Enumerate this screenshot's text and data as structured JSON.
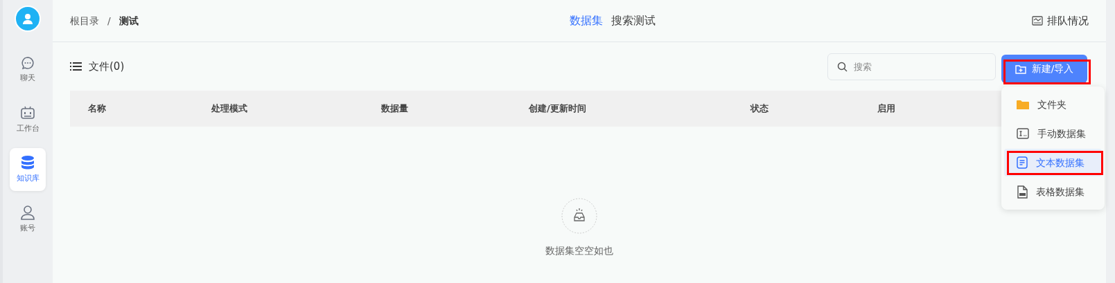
{
  "sidebar": {
    "items": [
      {
        "label": "聊天",
        "kind": "chat",
        "selected": false
      },
      {
        "label": "工作台",
        "kind": "robot",
        "selected": false
      },
      {
        "label": "知识库",
        "kind": "database",
        "selected": true
      },
      {
        "label": "账号",
        "kind": "user",
        "selected": false
      }
    ]
  },
  "breadcrumb": [
    {
      "label": "根目录",
      "current": false
    },
    {
      "label": "测试",
      "current": true
    }
  ],
  "breadcrumb_separator": "/",
  "tabs": [
    {
      "label": "数据集",
      "selected": true
    },
    {
      "label": "搜索测试",
      "selected": false
    }
  ],
  "queue_button": {
    "label": "排队情况"
  },
  "files_title": "文件(0)",
  "search": {
    "placeholder": "搜索"
  },
  "create_button": {
    "label": "新建/导入",
    "highlighted": true
  },
  "table": {
    "columns": [
      "名称",
      "处理模式",
      "数据量",
      "创建/更新时间",
      "状态",
      "启用"
    ]
  },
  "empty_message": "数据集空空如也",
  "menu": {
    "items": [
      {
        "label": "文件夹",
        "kind": "folder",
        "selected": false,
        "highlighted": false
      },
      {
        "label": "手动数据集",
        "kind": "manual",
        "selected": false,
        "highlighted": false
      },
      {
        "label": "文本数据集",
        "kind": "text",
        "selected": true,
        "highlighted": true
      },
      {
        "label": "表格数据集",
        "kind": "csv",
        "selected": false,
        "highlighted": false
      }
    ]
  }
}
